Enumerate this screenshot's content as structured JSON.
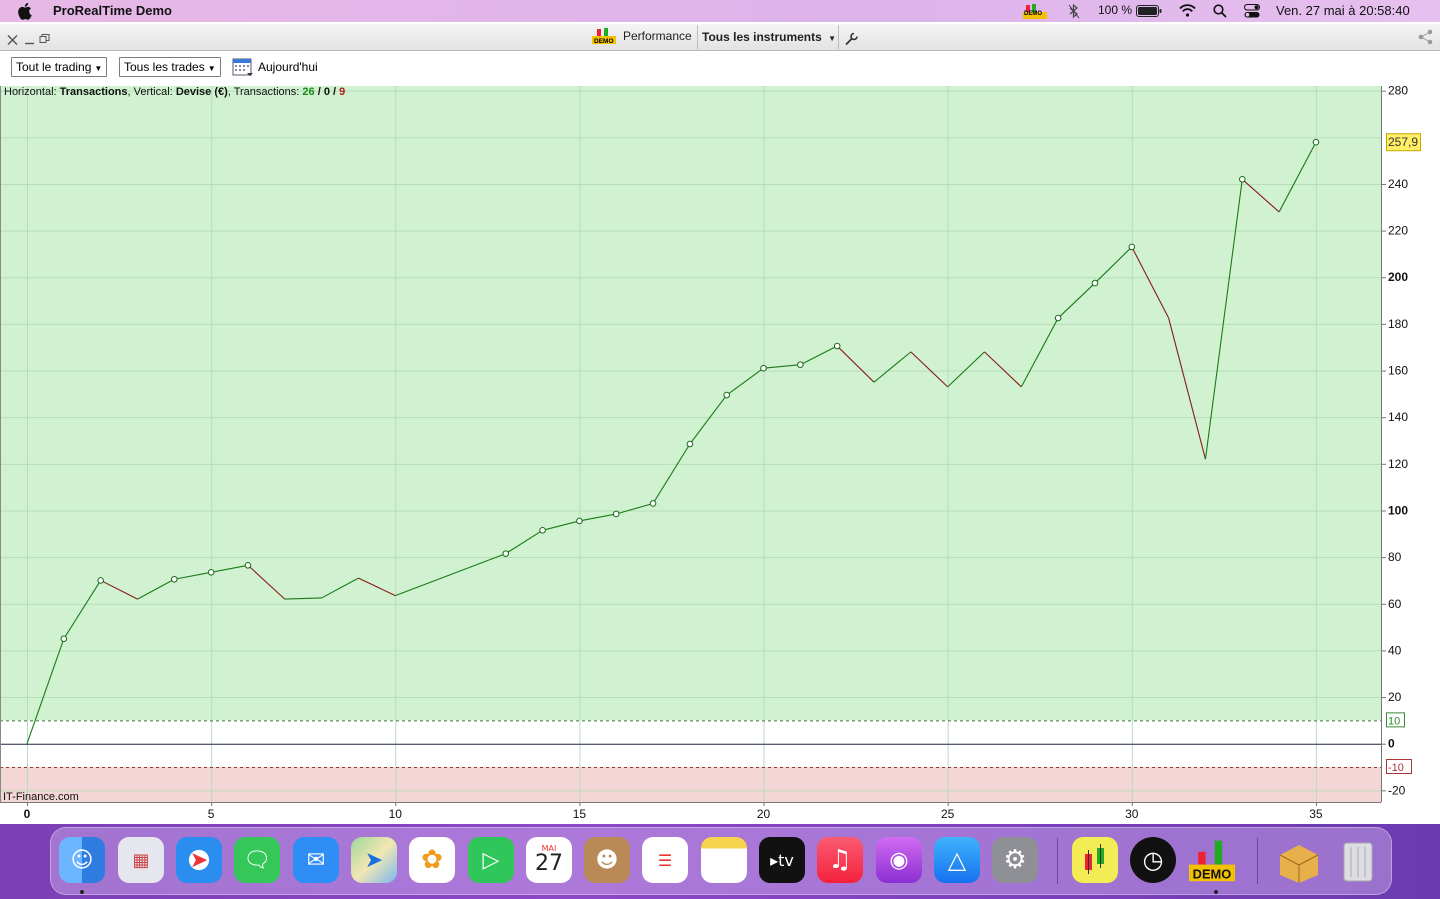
{
  "menubar": {
    "app_name": "ProRealTime Demo",
    "battery": "100 %",
    "clock": "Ven. 27 mai à  20:58:40",
    "demo_badge": "DEMO"
  },
  "titlebar": {
    "performance": "Performance",
    "instruments": "Tous les instruments"
  },
  "toolbar": {
    "trading_filter": "Tout le trading",
    "trades_filter": "Tous les trades",
    "date_label": "Aujourd'hui"
  },
  "chart_header": {
    "h_label": "Horizontal:",
    "h_value": "Transactions",
    "v_label": ", Vertical:",
    "v_value": "Devise (€)",
    "t_label": ", Transactions:",
    "t_wins": "26",
    "t_sep1": "/",
    "t_neutral": "0",
    "t_sep2": "/",
    "t_losses": "9"
  },
  "watermark": "IT-Finance.com",
  "colors": {
    "up": "#1a7a1a",
    "down": "#8b1a1a",
    "profit_zone": "#d0f2d0",
    "loss_zone": "#f4d6d6",
    "last_value_bg": "#ffee66"
  },
  "chart_data": {
    "type": "line",
    "xlabel": "Transactions",
    "ylabel": "Devise (€)",
    "x": [
      0,
      1,
      2,
      3,
      4,
      5,
      6,
      7,
      8,
      9,
      10,
      11,
      12,
      13,
      14,
      15,
      16,
      17,
      18,
      19,
      20,
      21,
      22,
      23,
      24,
      25,
      26,
      27,
      28,
      29,
      30,
      31,
      32,
      33,
      34,
      35
    ],
    "values": [
      0,
      45,
      70,
      62,
      70.5,
      73.5,
      76.5,
      62,
      62.5,
      71,
      63.5,
      69.5,
      75.5,
      81.5,
      91.5,
      95.5,
      98.5,
      103,
      128.5,
      149.5,
      161,
      162.5,
      170.5,
      155,
      168,
      153,
      168,
      153,
      182.5,
      197.5,
      213,
      182.5,
      122,
      242,
      228,
      257.9
    ],
    "markers": [
      false,
      true,
      true,
      false,
      true,
      true,
      true,
      false,
      false,
      false,
      false,
      false,
      false,
      true,
      true,
      true,
      true,
      true,
      true,
      true,
      true,
      true,
      true,
      false,
      false,
      false,
      false,
      false,
      true,
      true,
      true,
      false,
      false,
      true,
      false,
      true
    ],
    "xlim": [
      0,
      37.5
    ],
    "ylim": [
      -25,
      282
    ],
    "x_ticks": [
      "0",
      "5",
      "10",
      "15",
      "20",
      "25",
      "30",
      "35"
    ],
    "y_ticks": [
      "280",
      "240",
      "220",
      "200",
      "180",
      "160",
      "140",
      "120",
      "100",
      "80",
      "60",
      "40",
      "20",
      "0",
      "-20"
    ],
    "threshold_labels": [
      "10",
      "-10"
    ],
    "last_value_label": "257,9"
  }
}
